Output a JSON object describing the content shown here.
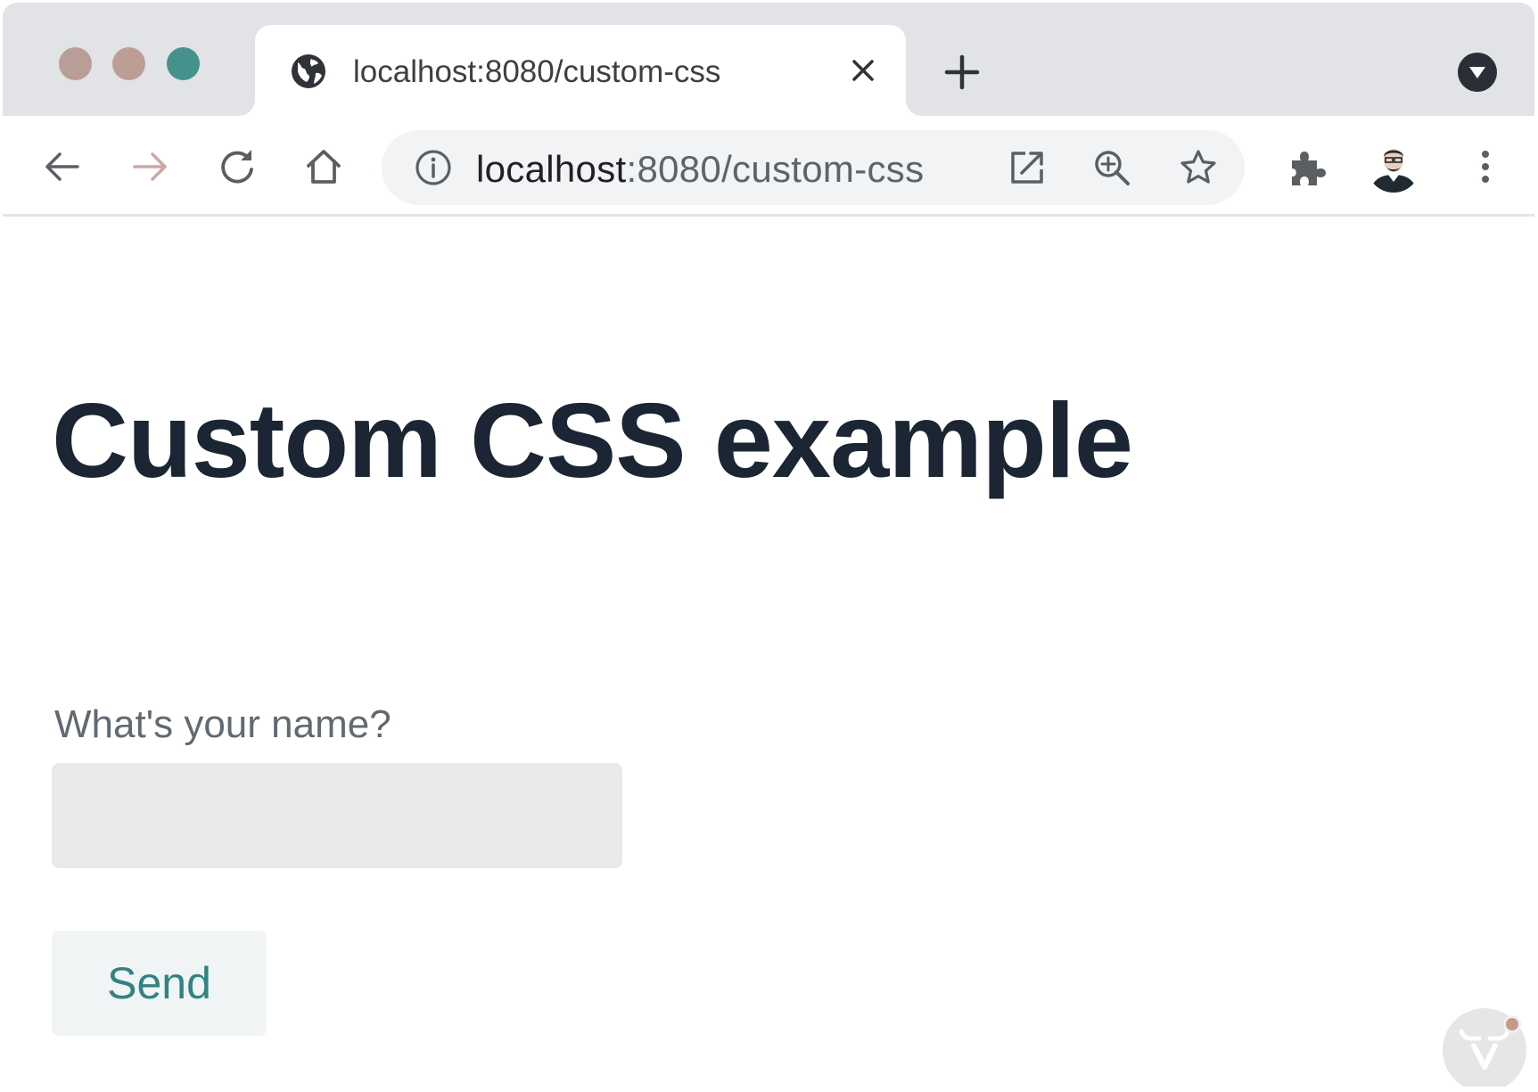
{
  "window": {
    "traffic_colors": {
      "close": "#b99e97",
      "minimize": "#bc9e96",
      "maximize": "#45928c"
    }
  },
  "tab": {
    "title": "localhost:8080/custom-css",
    "favicon": "globe-icon",
    "close_icon": "close-icon"
  },
  "toolbar": {
    "icons": [
      "arrow-left-icon",
      "arrow-right-icon",
      "reload-icon",
      "home-icon",
      "puzzle-icon",
      "kebab-menu-icon"
    ]
  },
  "omnibox": {
    "host": "localhost",
    "path": ":8080/custom-css",
    "icons": [
      "info-icon",
      "open-external-icon",
      "zoom-icon",
      "star-icon"
    ]
  },
  "page": {
    "title": "Custom CSS example",
    "name_label": "What's your name?",
    "name_value": "",
    "send_label": "Send"
  },
  "colors": {
    "heading": "#1b2533",
    "label": "#616972",
    "input_bg": "#e7e9eb",
    "accent": "#2e8482",
    "button_bg": "#f1f4f4"
  }
}
